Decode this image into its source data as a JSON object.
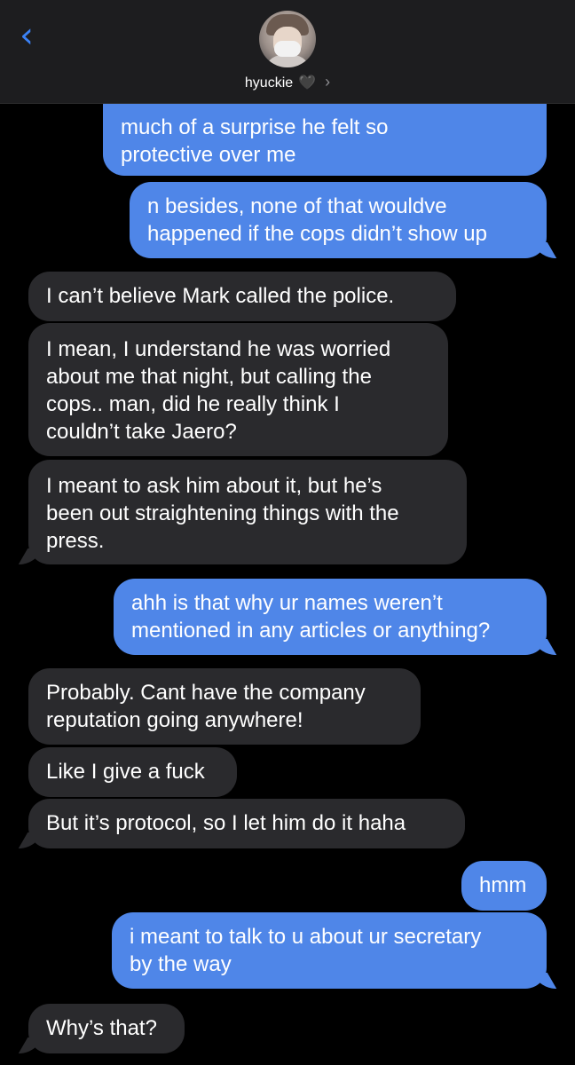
{
  "header": {
    "back_icon": "chevron-left-icon",
    "contact_name": "hyuckie",
    "heart": "🖤",
    "chevron": "›"
  },
  "messages": [
    {
      "from": "me",
      "lines": [
        "much of a surprise he felt so",
        "protective over me"
      ]
    },
    {
      "from": "me",
      "lines": [
        "n besides, none of that wouldve",
        "happened if the cops didn’t show up"
      ]
    },
    {
      "from": "them",
      "lines": [
        "I can’t believe Mark called the police."
      ]
    },
    {
      "from": "them",
      "lines": [
        "I mean, I understand he was worried",
        "about me that night, but calling the",
        "cops.. man, did he really think I",
        "couldn’t take Jaero?"
      ]
    },
    {
      "from": "them",
      "lines": [
        "I meant to ask him about it, but he’s",
        "been out straightening things with the",
        "press."
      ]
    },
    {
      "from": "me",
      "lines": [
        "ahh is that why ur names weren’t",
        "mentioned in any articles or anything?"
      ]
    },
    {
      "from": "them",
      "lines": [
        "Probably. Cant have the company",
        "reputation going anywhere!"
      ]
    },
    {
      "from": "them",
      "lines": [
        "Like I give a fuck"
      ]
    },
    {
      "from": "them",
      "lines": [
        "But it’s protocol, so I let him do it haha"
      ]
    },
    {
      "from": "me",
      "lines": [
        "hmm"
      ]
    },
    {
      "from": "me",
      "lines": [
        "i meant to talk to u about ur secretary",
        "by the way"
      ]
    },
    {
      "from": "them",
      "lines": [
        "Why’s that?"
      ]
    }
  ]
}
